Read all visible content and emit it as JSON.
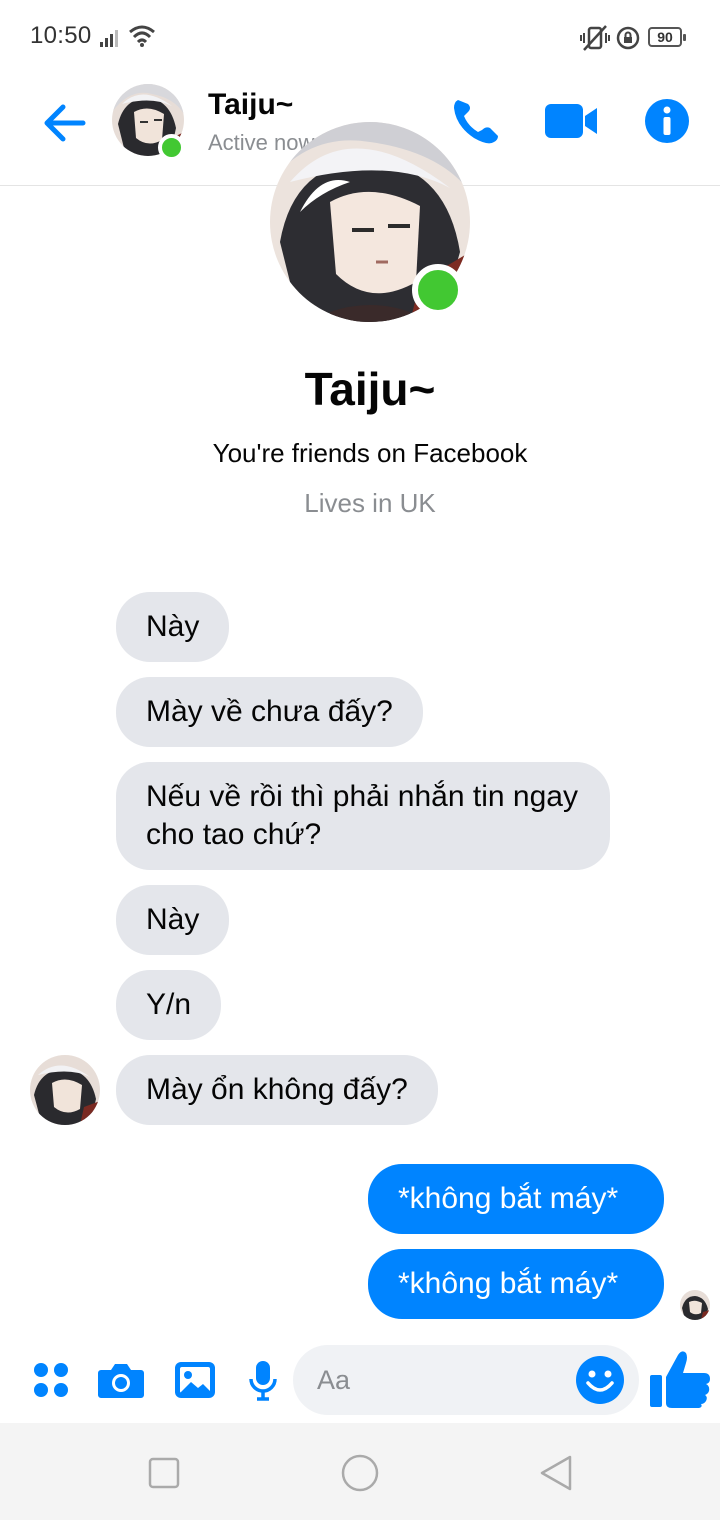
{
  "status_bar": {
    "time": "10:50",
    "battery": "90"
  },
  "header": {
    "name": "Taiju~",
    "status": "Active now",
    "online_color": "#42c832",
    "accent": "#0084ff"
  },
  "profile": {
    "name": "Taiju~",
    "friends_text": "You're friends on Facebook",
    "lives_text": "Lives in UK"
  },
  "messages": [
    {
      "side": "incoming",
      "text": "Này"
    },
    {
      "side": "incoming",
      "text": "Mày về chưa đấy?"
    },
    {
      "side": "incoming",
      "text": "Nếu về rồi thì phải nhắn tin ngay cho tao chứ?"
    },
    {
      "side": "incoming",
      "text": "Này"
    },
    {
      "side": "incoming",
      "text": "Y/n"
    },
    {
      "side": "incoming",
      "text": "Mày ổn không đấy?"
    },
    {
      "side": "outgoing",
      "text": "*không bắt máy*"
    },
    {
      "side": "outgoing",
      "text": "*không bắt máy*"
    }
  ],
  "composer": {
    "placeholder": "Aa",
    "icons": [
      "menu-grid-icon",
      "camera-icon",
      "image-icon",
      "microphone-icon",
      "emoji-icon",
      "thumbs-up-icon"
    ]
  },
  "navbar": {
    "icons": [
      "recent-apps-icon",
      "home-icon",
      "back-triangle-icon"
    ]
  }
}
